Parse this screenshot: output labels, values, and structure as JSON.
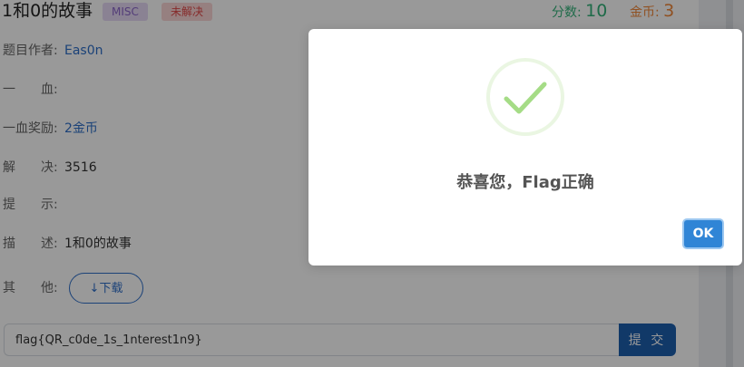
{
  "header": {
    "title": "1和0的故事",
    "category_tag": "MISC",
    "status_tag": "未解决",
    "score_label": "分数:",
    "score_value": "10",
    "coin_label": "金币:",
    "coin_value": "3"
  },
  "info": {
    "author_label": "题目作者:",
    "author_value": "Eas0n",
    "first_blood_label": "一　　血:",
    "first_blood_value": "",
    "first_blood_reward_label": "一血奖励:",
    "first_blood_reward_value": "2金币",
    "solved_label": "解　　决:",
    "solved_value": "3516",
    "hint_label": "提　　示:",
    "hint_value": "",
    "description_label": "描　　述:",
    "description_value": "1和0的故事",
    "other_label": "其　　他:",
    "download_label": "下载"
  },
  "flag_form": {
    "input_value": "flag{QR_c0de_1s_1nterest1n9}",
    "submit_label": "提 交"
  },
  "modal": {
    "message": "恭喜您，Flag正确",
    "ok_label": "OK",
    "icon": "success-check-icon"
  },
  "colors": {
    "accent_blue": "#2e6ec9",
    "score_green": "#34b27a",
    "coin_orange": "#f0883a",
    "success_green": "#a5dc86",
    "ok_button": "#3085d6"
  }
}
